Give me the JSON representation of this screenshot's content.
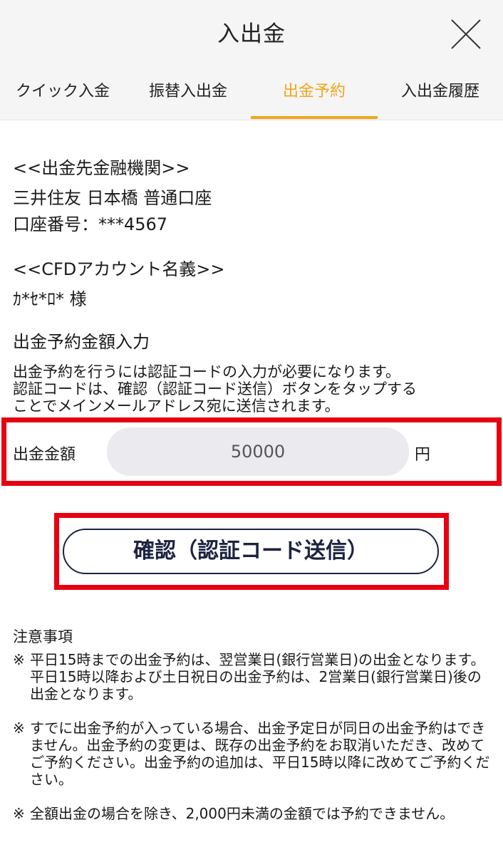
{
  "header": {
    "title": "入出金",
    "tabs": [
      {
        "label": "クイック入金",
        "active": false
      },
      {
        "label": "振替入出金",
        "active": false
      },
      {
        "label": "出金予約",
        "active": true
      },
      {
        "label": "入出金履歴",
        "active": false
      }
    ],
    "accent_color": "#f0a51b"
  },
  "bank": {
    "heading": "<<出金先金融機関>>",
    "name": "三井住友 日本橋 普通口座",
    "account": "口座番号：***4567"
  },
  "cfd": {
    "heading": "<<CFDアカウント名義>>",
    "holder": "ｶ*ｾ*ﾛ* 様"
  },
  "reservation": {
    "heading": "出金予約金額入力",
    "description": [
      "出金予約を行うには認証コードの入力が必要になります。",
      "認証コードは、確認（認証コード送信）ボタンをタップする",
      "ことでメインメールアドレス宛に送信されます。"
    ],
    "amount_label": "出金金額",
    "amount_value": "50000",
    "currency": "円",
    "confirm_button": "確認（認証コード送信）",
    "highlight_color": "#e60012"
  },
  "notes": {
    "heading": "注意事項",
    "mark": "※",
    "items": [
      "平日15時までの出金予約は、翌営業日(銀行営業日)の出金となります。平日15時以降および土日祝日の出金予約は、2営業日(銀行営業日)後の出金となります。",
      "すでに出金予約が入っている場合、出金予定日が同日の出金予約はできません。出金予約の変更は、既存の出金予約をお取消いただき、改めてご予約ください。出金予約の追加は、平日15時以降に改めてご予約ください。",
      "全額出金の場合を除き、2,000円未満の金額では予約できません。"
    ]
  }
}
